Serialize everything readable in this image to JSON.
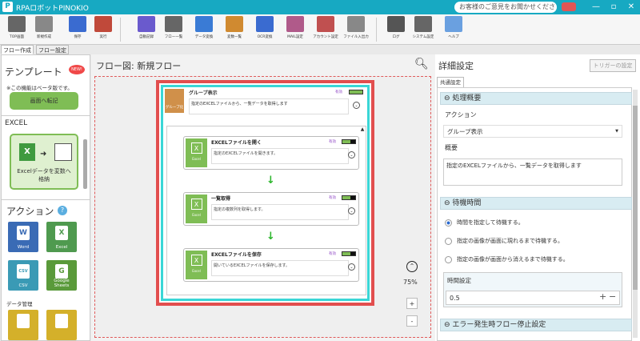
{
  "app": {
    "title": "RPAロボットPINOKIO",
    "feedback": "お客様のご意見をお聞かせください",
    "min": "—",
    "max": "▫",
    "close": "✕"
  },
  "toolbar": {
    "items": [
      {
        "label": "TOP画面",
        "icon": "home-icon",
        "color": "#666"
      },
      {
        "label": "新規作成",
        "icon": "new-file-icon",
        "color": "#888"
      },
      {
        "label": "保存",
        "icon": "save-icon",
        "color": "#3a6bd0"
      },
      {
        "label": "実行",
        "icon": "play-icon",
        "color": "#c0493a"
      },
      {
        "label": "自動記録",
        "icon": "record-icon",
        "color": "#6a5acd"
      },
      {
        "label": "フロー一覧",
        "icon": "flow-list-icon",
        "color": "#666"
      },
      {
        "label": "データ変換",
        "icon": "data-convert-icon",
        "color": "#3a7bd5"
      },
      {
        "label": "変数一覧",
        "icon": "variables-icon",
        "color": "#d08a30"
      },
      {
        "label": "OCR変換",
        "icon": "ocr-icon",
        "color": "#3a6bd0"
      },
      {
        "label": "MAIL設定",
        "icon": "mail-icon",
        "color": "#b05a8a"
      },
      {
        "label": "アカウント設定",
        "icon": "account-icon",
        "color": "#c05050"
      },
      {
        "label": "ファイル入出力",
        "icon": "file-io-icon",
        "color": "#888"
      },
      {
        "label": "ログ",
        "icon": "log-icon",
        "color": "#555"
      },
      {
        "label": "システム設定",
        "icon": "gear-icon",
        "color": "#666"
      },
      {
        "label": "ヘルプ",
        "icon": "help-icon",
        "color": "#6aa0e0"
      }
    ]
  },
  "tabs": [
    "フロー作成",
    "フロー設定"
  ],
  "left": {
    "template_title": "テンプレート",
    "new_badge": "NEW!",
    "beta_note": "※この機能はベータ版です。",
    "card_partial": "画面へ転記",
    "excel_section": "EXCEL",
    "excel_card": "Excelデータを変数へ格納",
    "actions_title": "アクション",
    "actions": [
      {
        "label": "Word",
        "glyph": "W",
        "color": "#3a6bb5"
      },
      {
        "label": "Excel",
        "glyph": "X",
        "color": "#4f9a4f"
      },
      {
        "label": "CSV",
        "glyph": "CSV",
        "color": "#3a9ab5"
      },
      {
        "label": "Google Sheets",
        "glyph": "G",
        "color": "#5a9a3a"
      }
    ],
    "data_mgmt": "データ管理"
  },
  "center": {
    "title": "フロー図:  新規フロー",
    "zoom": "75%",
    "zoom_in": "+",
    "zoom_out": "-",
    "group": {
      "title": "グループ表示",
      "tag": "グループ化",
      "desc": "指定のEXCELファイルから、一覧データを取得します",
      "status": "有効"
    },
    "steps": [
      {
        "title": "EXCELファイルを開く",
        "desc": "指定のEXCELファイルを開きます。",
        "status": "有効",
        "icon": "Excel"
      },
      {
        "title": "一覧取得",
        "desc": "指定の複数列を取得します。",
        "status": "有効",
        "icon": "Excel"
      },
      {
        "title": "EXCELファイルを保存",
        "desc": "開いているEXCELファイルを保存します。",
        "status": "有効",
        "icon": "Excel"
      }
    ]
  },
  "right": {
    "title": "詳細設定",
    "trigger_btn": "トリガーの設定",
    "tab": "共通設定",
    "sec1": "処理概要",
    "action_label": "アクション",
    "action_value": "グループ表示",
    "summary_label": "概要",
    "summary_value": "指定のEXCELファイルから、一覧データを取得します",
    "sec2": "待機時間",
    "radios": [
      "時間を指定して待機する。",
      "指定の画像が画面に現れるまで待機する。",
      "指定の画像が画面から消えるまで待機する。"
    ],
    "time_label": "時間設定",
    "time_value": "0.5",
    "sec3": "エラー発生時フロー停止設定"
  }
}
